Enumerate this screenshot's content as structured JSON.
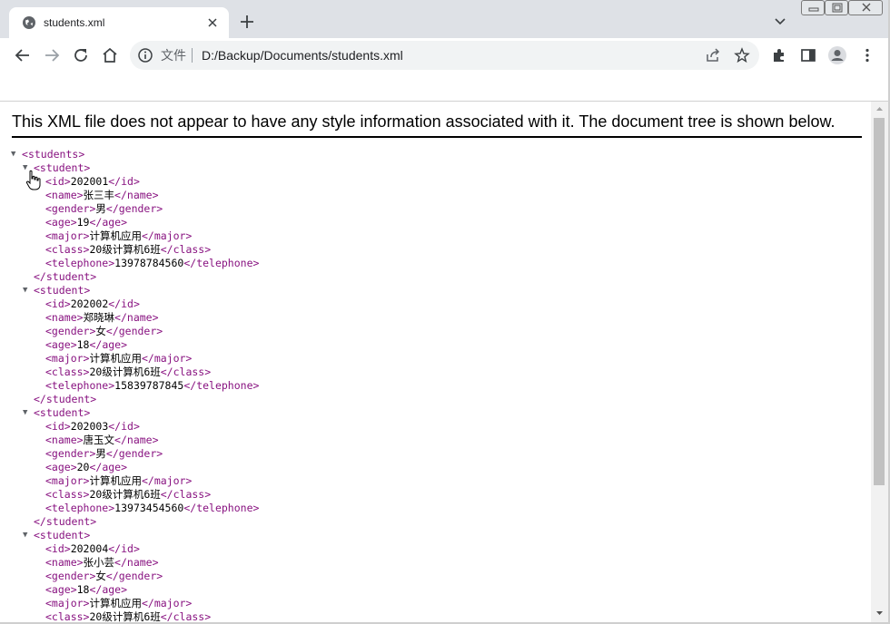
{
  "tab": {
    "title": "students.xml",
    "favicon": "globe-icon",
    "close_icon": "close-icon"
  },
  "toolbar": {
    "back_icon": "arrow-left-icon",
    "forward_icon": "arrow-right-icon",
    "reload_icon": "reload-icon",
    "home_icon": "home-icon",
    "address": {
      "scheme_label": "文件",
      "url": "D:/Backup/Documents/students.xml"
    },
    "extensions_icon": "puzzle-icon",
    "sidepanel_icon": "side-panel-icon",
    "profile_icon": "avatar-icon",
    "menu_icon": "kebab-menu-icon"
  },
  "content": {
    "info_text": "This XML file does not appear to have any style information associated with it. The document tree is shown below.",
    "root_tag": "students",
    "students": [
      {
        "id": "202001",
        "name": "张三丰",
        "gender": "男",
        "age": "19",
        "major": "计算机应用",
        "class": "20级计算机6班",
        "telephone": "13978784560"
      },
      {
        "id": "202002",
        "name": "郑晓琳",
        "gender": "女",
        "age": "18",
        "major": "计算机应用",
        "class": "20级计算机6班",
        "telephone": "15839787845"
      },
      {
        "id": "202003",
        "name": "唐玉文",
        "gender": "男",
        "age": "20",
        "major": "计算机应用",
        "class": "20级计算机6班",
        "telephone": "13973454560"
      },
      {
        "id": "202004",
        "name": "张小芸",
        "gender": "女",
        "age": "18",
        "major": "计算机应用",
        "class": "20级计算机6班",
        "telephone": ""
      }
    ]
  },
  "colors": {
    "tag": "#881280",
    "tab_strip": "#dee1e6",
    "omnibox": "#f1f3f4"
  }
}
